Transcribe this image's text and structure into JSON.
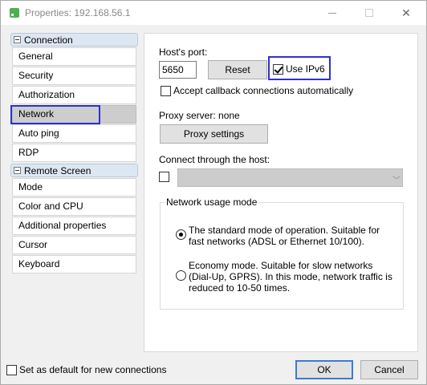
{
  "window": {
    "title": "Properties: 192.168.56.1",
    "minimize_icon": "minimize-icon",
    "maximize_icon": "maximize-icon",
    "close_glyph": "✕"
  },
  "sidebar": {
    "groups": [
      {
        "label": "Connection",
        "items": [
          "General",
          "Security",
          "Authorization",
          "Network",
          "Auto ping",
          "RDP"
        ]
      },
      {
        "label": "Remote Screen",
        "items": [
          "Mode",
          "Color and CPU",
          "Additional properties",
          "Cursor",
          "Keyboard"
        ]
      }
    ],
    "selected": "Network"
  },
  "network": {
    "hosts_port_label": "Host's port:",
    "port_value": "5650",
    "reset_label": "Reset",
    "use_ipv6_label": "Use IPv6",
    "use_ipv6_checked": true,
    "accept_callback_label": "Accept callback connections automatically",
    "accept_callback_checked": false,
    "proxy_server_label": "Proxy server: none",
    "proxy_settings_label": "Proxy settings",
    "connect_through_label": "Connect through the host:",
    "connect_through_checked": false,
    "connect_through_value": "",
    "usage_mode_legend": "Network usage mode",
    "mode_standard_text": "The standard mode of operation. Suitable for fast networks (ADSL or Ethernet 10/100).",
    "mode_economy_text": "Economy mode. Suitable for slow networks (Dial-Up, GPRS). In this mode, network traffic is reduced to 10-50 times.",
    "selected_mode": "standard"
  },
  "footer": {
    "set_default_label": "Set as default for new connections",
    "set_default_checked": false,
    "ok_label": "OK",
    "cancel_label": "Cancel"
  },
  "colors": {
    "highlight": "#2f2fd3",
    "group_header_bg": "#dde7f3",
    "selected_item_bg": "#cdcdcd",
    "ok_border": "#3b7bd6"
  }
}
